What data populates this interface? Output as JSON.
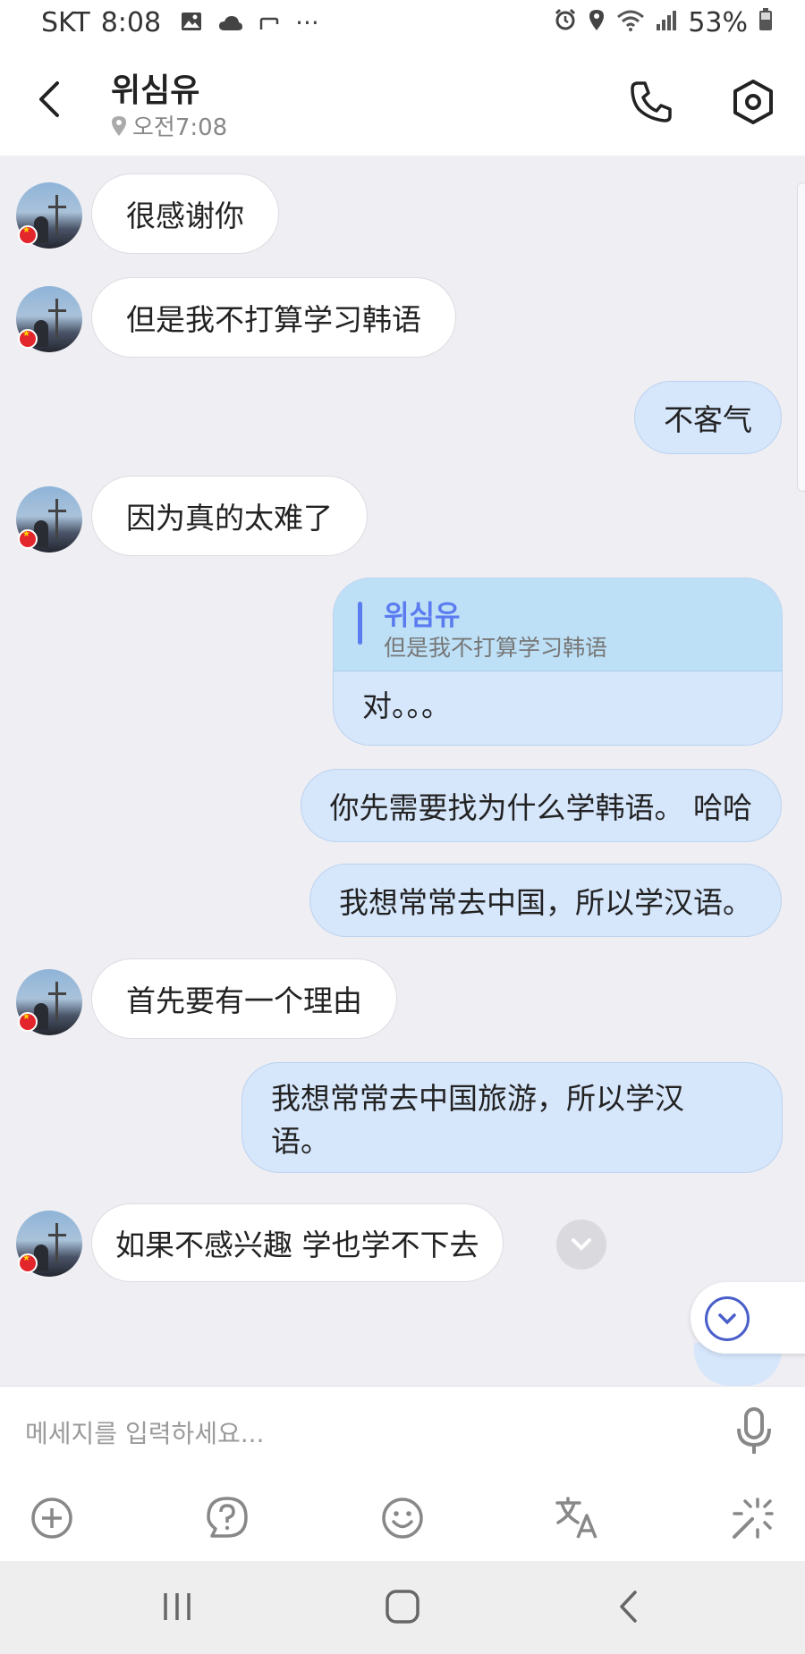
{
  "status_bar": {
    "carrier": "SKT",
    "time": "8:08",
    "battery": "53%",
    "more": "···"
  },
  "header": {
    "contact_name": "위심유",
    "local_time": "오전7:08"
  },
  "messages": [
    {
      "side": "in",
      "text": "很感谢你"
    },
    {
      "side": "in",
      "text": "但是我不打算学习韩语"
    },
    {
      "side": "out",
      "text": "不客气"
    },
    {
      "side": "in",
      "text": "因为真的太难了"
    },
    {
      "side": "out",
      "reply_to_name": "위심유",
      "reply_to_text": "但是我不打算学习韩语",
      "text": "对。。。"
    },
    {
      "side": "out",
      "text": "你先需要找为什么学韩语。 哈哈"
    },
    {
      "side": "out",
      "text": "我想常常去中国，所以学汉语。"
    },
    {
      "side": "in",
      "text": "首先要有一个理由"
    },
    {
      "side": "out",
      "text_line1": "我想常常去中国旅游，所以学汉",
      "text_line2": "语。"
    },
    {
      "side": "in",
      "text": "如果不感兴趣 学也学不下去"
    }
  ],
  "input": {
    "placeholder": "메세지를 입력하세요..."
  },
  "toolbar_icons": [
    "add-icon",
    "help-icon",
    "emoji-icon",
    "translate-icon",
    "magic-wand-icon"
  ],
  "navbar_icons": [
    "recent-apps-icon",
    "home-icon",
    "back-icon"
  ],
  "colors": {
    "chat_background": "#eeeef3",
    "outgoing_bubble": "#d6e6fb",
    "incoming_bubble": "#ffffff",
    "reply_quote_bg": "#bde0f6",
    "accent": "#5b7cf0"
  }
}
